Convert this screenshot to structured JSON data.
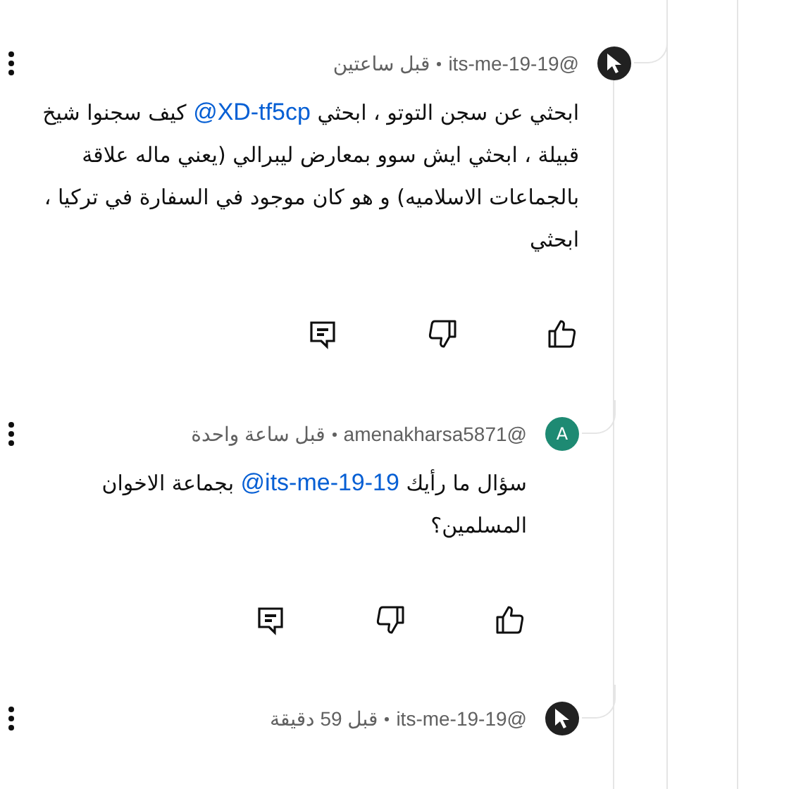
{
  "comments": [
    {
      "avatar": {
        "kind": "cursor"
      },
      "author": "@its-me-19-19",
      "time": "قبل ساعتين",
      "body": [
        {
          "kind": "text",
          "text": "ابحثي عن سجن التوتو ، ابحثي "
        },
        {
          "kind": "mention",
          "text": "@XD-tf5cp"
        },
        {
          "kind": "text",
          "text": " كيف سجنوا شيخ قبيلة ، ابحثي ايش سوو بمعارض ليبرالي (يعني ماله علاقة بالجماعات الاسلاميه) و هو كان موجود في السفارة في تركيا ، ابحثي"
        }
      ],
      "replies": [
        {
          "avatar": {
            "kind": "letter",
            "letter": "A",
            "color": "#1e8a73"
          },
          "author": "@amenakharsa5871",
          "time": "قبل ساعة واحدة",
          "body": [
            {
              "kind": "text",
              "text": "سؤال ما رأيك "
            },
            {
              "kind": "mention",
              "text": "@its-me-19-19"
            },
            {
              "kind": "text",
              "text": " بجماعة الاخوان المسلمين؟"
            }
          ]
        },
        {
          "avatar": {
            "kind": "cursor"
          },
          "author": "@its-me-19-19",
          "time": "قبل 59 دقيقة"
        }
      ]
    }
  ]
}
